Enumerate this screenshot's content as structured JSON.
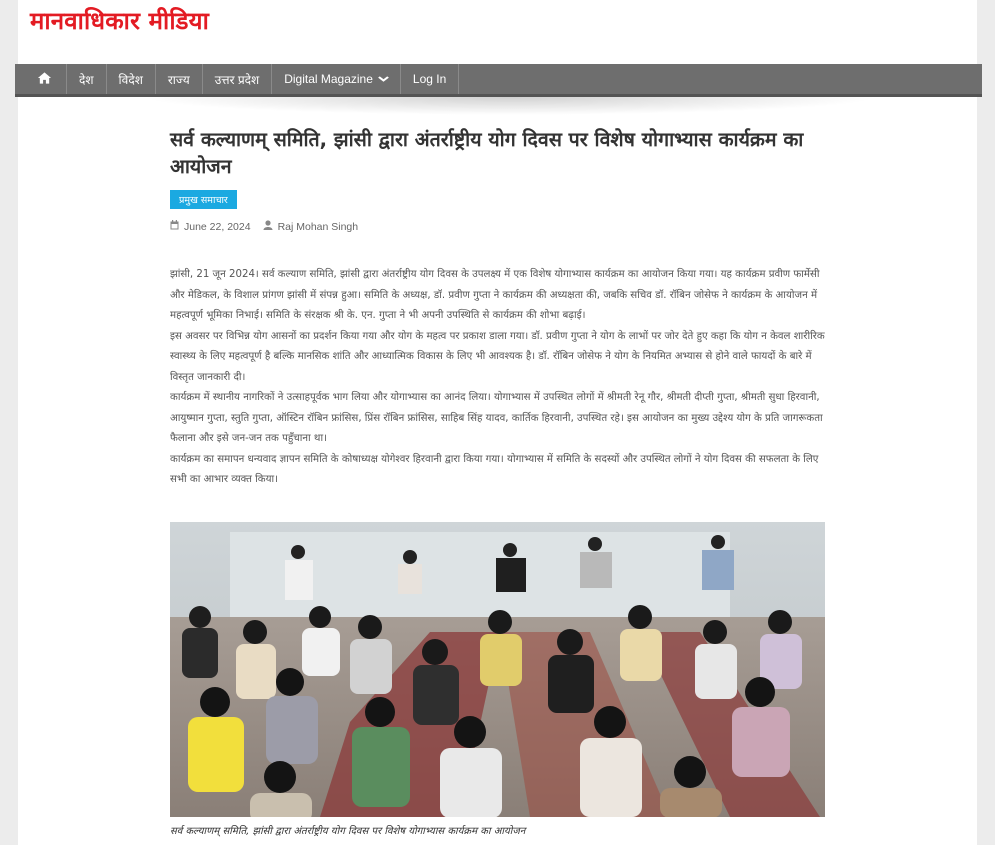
{
  "site": {
    "title": "मानवाधिकार मीडिया"
  },
  "nav": {
    "items": [
      {
        "label": "देश"
      },
      {
        "label": "विदेश"
      },
      {
        "label": "राज्य"
      },
      {
        "label": "उत्तर प्रदेश"
      },
      {
        "label": "Digital Magazine",
        "dropdown": true
      },
      {
        "label": "Log In"
      }
    ]
  },
  "article": {
    "title": "सर्व कल्याणम् समिति, झांसी द्वारा अंतर्राष्ट्रीय योग दिवस पर विशेष योगाभ्यास कार्यक्रम का आयोजन",
    "category": "प्रमुख समाचार",
    "date": "June 22, 2024",
    "author": "Raj Mohan Singh",
    "paragraphs": [
      "झांसी, 21 जून 2024। सर्व कल्याण समिति, झांसी द्वारा अंतर्राष्ट्रीय योग दिवस के उपलक्ष्य में एक विशेष योगाभ्यास कार्यक्रम का आयोजन किया गया। यह कार्यक्रम प्रवीण फार्मेसी और मेडिकल, के विशाल प्रांगण झांसी में संपन्न हुआ। समिति के अध्यक्ष, डॉ. प्रवीण गुप्ता ने कार्यक्रम की अध्यक्षता की, जबकि सचिव डॉ. रॉबिन जोसेफ ने कार्यक्रम के आयोजन में महत्वपूर्ण भूमिका निभाई। समिति के संरक्षक श्री के. एन. गुप्ता ने भी अपनी उपस्थिति से कार्यक्रम की शोभा बढ़ाई।",
      "इस अवसर पर विभिन्न योग आसनों का प्रदर्शन किया गया और योग के महत्व पर प्रकाश डाला गया। डॉ. प्रवीण गुप्ता ने योग के लाभों पर जोर देते हुए कहा कि योग न केवल शारीरिक स्वास्थ्य के लिए महत्वपूर्ण है बल्कि मानसिक शांति और आध्यात्मिक विकास के लिए भी आवश्यक है। डॉ. रॉबिन जोसेफ ने योग के नियमित अभ्यास से होने वाले फायदों के बारे में विस्तृत जानकारी दी।",
      "कार्यक्रम में स्थानीय नागरिकों ने उत्साहपूर्वक भाग लिया और योगाभ्यास का आनंद लिया। योगाभ्यास में उपस्थित लोगों में श्रीमती रेनू गौर, श्रीमती दीप्ती गुप्ता, श्रीमती सुधा हिरवानी, आयुष्मान गुप्ता, स्तुति गुप्ता, ऑस्टिन रॉबिन फ्रांसिस, प्रिंस रॉबिन फ्रांसिस, साहिब सिंह यादव, कार्तिक हिरवानी, उपस्थित रहे। इस आयोजन का मुख्य उद्देश्य योग के प्रति जागरूकता फैलाना और इसे जन-जन तक पहुँचाना था।",
      "कार्यक्रम का समापन धन्यवाद ज्ञापन समिति के कोषाध्यक्ष योगेश्वर हिरवानी द्वारा किया गया। योगाभ्यास में समिति के सदस्यों और उपस्थित लोगों ने योग दिवस की सफलता के लिए सभी का आभार व्यक्त किया।"
    ],
    "image_caption": "सर्व कल्याणम् समिति, झांसी द्वारा अंतर्राष्ट्रीय योग दिवस पर विशेष योगाभ्यास कार्यक्रम का आयोजन"
  },
  "icons": {
    "home": "home-icon",
    "calendar": "calendar-icon",
    "user": "user-icon",
    "dropdown": "chevron-down-icon"
  },
  "colors": {
    "brand": "#e31b23",
    "nav": "#6e6e6e",
    "category": "#1ba9e1"
  }
}
